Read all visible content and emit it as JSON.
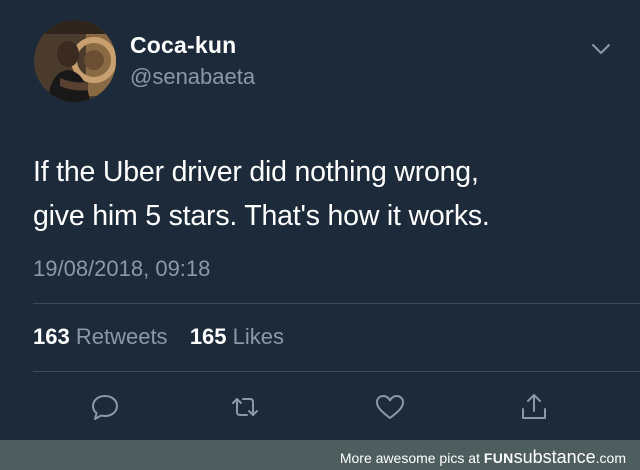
{
  "tweet": {
    "display_name": "Coca-kun",
    "handle": "@senabaeta",
    "text_lines": [
      "If the Uber driver did nothing wrong,",
      "give him 5 stars. That's how it works."
    ],
    "timestamp": "19/08/2018, 09:18",
    "retweets_count": "163",
    "retweets_label": "Retweets",
    "likes_count": "165",
    "likes_label": "Likes"
  },
  "icons": {
    "menu": "chevron-down-icon",
    "reply": "reply-icon",
    "retweet": "retweet-icon",
    "like": "heart-icon",
    "share": "share-icon"
  },
  "footer": {
    "prefix": "More awesome pics at",
    "brand_bold": "FUN",
    "brand_light": "substance",
    "brand_suffix": ".com"
  },
  "colors": {
    "background": "#1c2a3a",
    "secondary_text": "#8a99a8",
    "footer_bar": "#4e5e5e"
  }
}
